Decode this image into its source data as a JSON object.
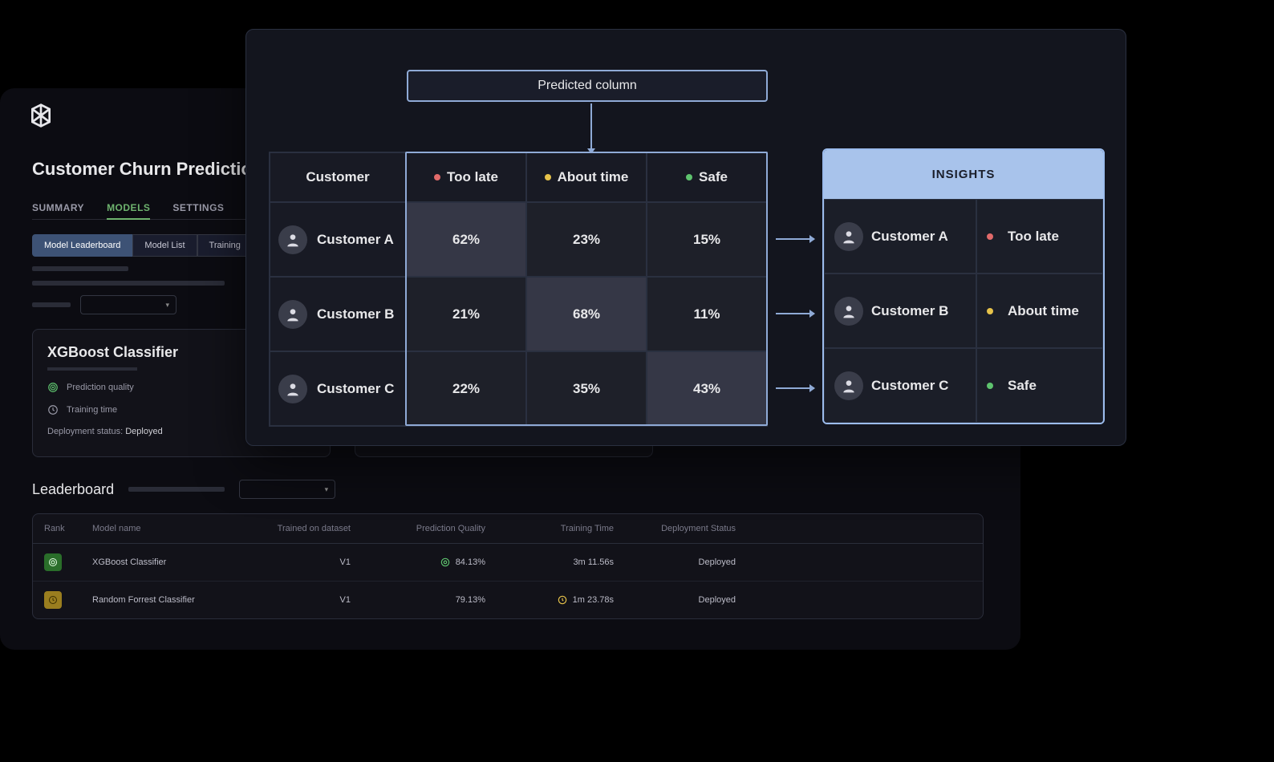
{
  "background": {
    "page_title": "Customer Churn Prediction",
    "tabs": [
      "SUMMARY",
      "MODELS",
      "SETTINGS"
    ],
    "active_tab": "MODELS",
    "subtabs": [
      "Model Leaderboard",
      "Model List",
      "Training"
    ],
    "active_subtab": "Model Leaderboard",
    "model_card": {
      "title": "XGBoost Classifier",
      "stat_quality_label": "Prediction quality",
      "stat_time_label": "Training time",
      "deploy_label": "Deployment status:",
      "deploy_value": "Deployed"
    },
    "leaderboard_title": "Leaderboard",
    "leaderboard_headers": [
      "Rank",
      "Model name",
      "Trained on dataset",
      "Prediction Quality",
      "Training Time",
      "Deployment Status"
    ],
    "leaderboard_rows": [
      {
        "icon": "green",
        "name": "XGBoost Classifier",
        "dataset": "V1",
        "pq": "84.13%",
        "tt": "3m 11.56s",
        "status": "Deployed",
        "pq_icon": "target",
        "tt_icon": ""
      },
      {
        "icon": "yellow",
        "name": "Random Forrest Classifier",
        "dataset": "V1",
        "pq": "79.13%",
        "tt": "1m 23.78s",
        "status": "Deployed",
        "pq_icon": "",
        "tt_icon": "clock"
      }
    ]
  },
  "overlay": {
    "predicted_label": "Predicted column",
    "headers": {
      "customer": "Customer",
      "too_late": "Too late",
      "about_time": "About time",
      "safe": "Safe"
    },
    "rows": [
      {
        "name": "Customer A",
        "too_late": "62%",
        "about_time": "23%",
        "safe": "15%",
        "highlight": "too_late",
        "insight": "Too late",
        "dot": "red"
      },
      {
        "name": "Customer B",
        "too_late": "21%",
        "about_time": "68%",
        "safe": "11%",
        "highlight": "about_time",
        "insight": "About time",
        "dot": "yellow"
      },
      {
        "name": "Customer C",
        "too_late": "22%",
        "about_time": "35%",
        "safe": "43%",
        "highlight": "safe",
        "insight": "Safe",
        "dot": "green"
      }
    ],
    "insights_header": "INSIGHTS"
  }
}
